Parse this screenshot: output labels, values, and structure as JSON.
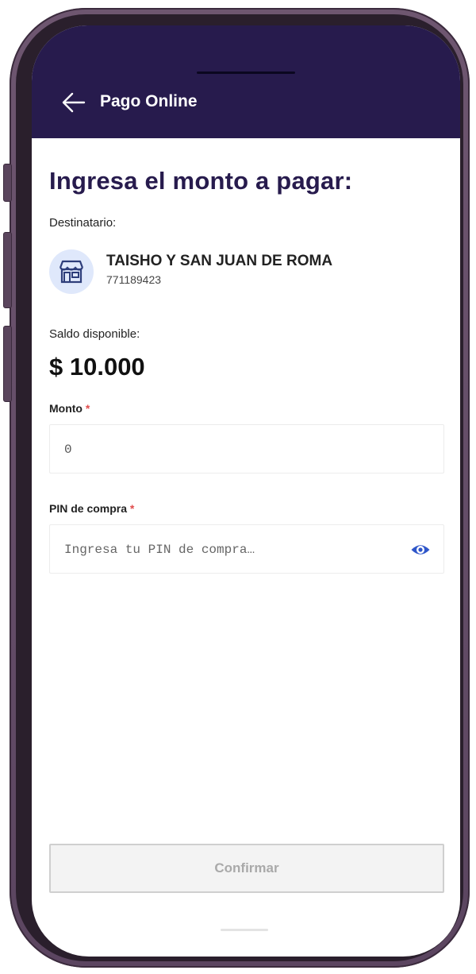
{
  "app_bar": {
    "title": "Pago Online",
    "back_icon": "arrow-left-icon",
    "background": "#271b4d"
  },
  "main": {
    "heading": "Ingresa el monto a pagar:",
    "recipient_label": "Destinatario:",
    "recipient": {
      "icon": "store-icon",
      "name": "TAISHO Y SAN JUAN DE ROMA",
      "id": "771189423"
    },
    "balance_label": "Saldo disponible:",
    "balance_value": "$ 10.000"
  },
  "form": {
    "amount_label": "Monto",
    "amount_required_mark": "*",
    "amount_value": "0",
    "pin_label": "PIN de compra",
    "pin_required_mark": "*",
    "pin_placeholder": "Ingresa tu PIN de compra…",
    "pin_visibility_icon": "eye-icon",
    "confirm_label": "Confirmar"
  },
  "colors": {
    "primary": "#271b4d",
    "required": "#e04d4d",
    "eye_icon": "#2f56c9",
    "disabled_text": "#a9a9a9"
  }
}
